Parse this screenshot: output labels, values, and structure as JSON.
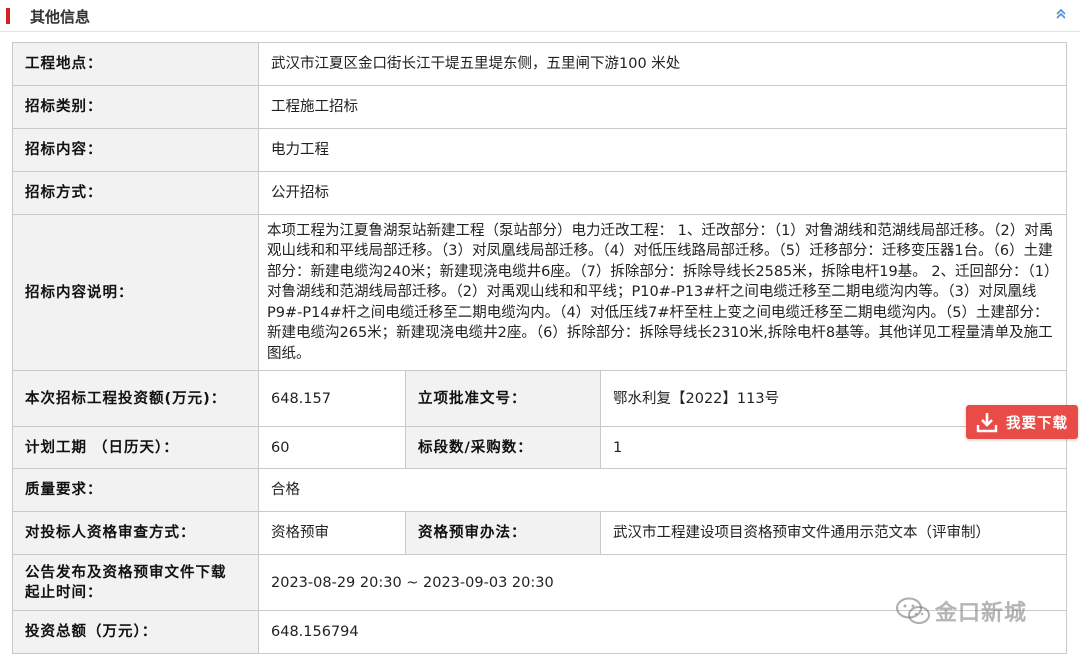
{
  "section": {
    "title": "其他信息",
    "collapse_icon": "double-chevron-up-icon",
    "accent_color": "#d2231f"
  },
  "rows": {
    "location": {
      "label": "工程地点：",
      "value": "武汉市江夏区金口街长江干堤五里堤东侧，五里闸下游100 米处"
    },
    "category": {
      "label": "招标类别：",
      "value": "工程施工招标"
    },
    "content": {
      "label": "招标内容：",
      "value": "电力工程"
    },
    "method": {
      "label": "招标方式：",
      "value": "公开招标"
    },
    "description": {
      "label": "招标内容说明：",
      "value": "本项工程为江夏鲁湖泵站新建工程（泵站部分）电力迁改工程：  1、迁改部分：（1）对鲁湖线和范湖线局部迁移。（2）对禹观山线和和平线局部迁移。（3）对凤凰线局部迁移。（4）对低压线路局部迁移。（5）迁移部分：迁移变压器1台。（6）土建部分：新建电缆沟240米；新建现浇电缆井6座。（7）拆除部分：拆除导线长2585米，拆除电杆19基。 2、迁回部分：（1）对鲁湖线和范湖线局部迁移。（2）对禹观山线和和平线；P10#-P13#杆之间电缆迁移至二期电缆沟内等。（3）对凤凰线P9#-P14#杆之间电缆迁移至二期电缆沟内。（4）对低压线7#杆至柱上变之间电缆迁移至二期电缆沟内。（5）土建部分：新建电缆沟265米；新建现浇电缆井2座。（6）拆除部分：拆除导线长2310米,拆除电杆8基等。其他详见工程量清单及施工图纸。"
    },
    "investment": {
      "label": "本次招标工程投资额(万元)：",
      "value": "648.157"
    },
    "approval_no": {
      "label": "立项批准文号：",
      "value": "鄂水利复【2022】113号"
    },
    "duration": {
      "label": "计划工期 （日历天）：",
      "value": "60"
    },
    "sections": {
      "label": "标段数/采购数：",
      "value": "1"
    },
    "quality": {
      "label": "质量要求：",
      "value": "合格"
    },
    "qualification": {
      "label": "对投标人资格审查方式：",
      "value": "资格预审"
    },
    "prequal_method": {
      "label": "资格预审办法：",
      "value": "武汉市工程建设项目资格预审文件通用示范文本（评审制）"
    },
    "period": {
      "label": "公告发布及资格预审文件下载 起止时间：",
      "value": "2023-08-29 20:30 ~ 2023-09-03 20:30"
    },
    "total_investment": {
      "label": "投资总额（万元）：",
      "value": "648.156794"
    }
  },
  "download": {
    "label": "我要下载",
    "icon": "download-icon",
    "color": "#e94b47"
  },
  "watermark": {
    "text": "金口新城",
    "icon": "wechat-icon"
  }
}
